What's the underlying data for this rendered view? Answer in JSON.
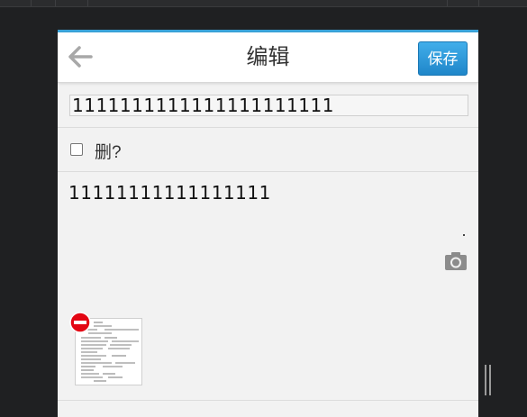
{
  "header": {
    "title": "编辑",
    "save_label": "保存",
    "back_icon": "arrow-left-icon"
  },
  "form": {
    "title_value": "1111111111111111111111",
    "delete_label": "删?",
    "delete_checked": false,
    "content_text": "11111111111111111"
  },
  "attachments": {
    "camera_icon": "camera-icon",
    "remove_icon": "minus-circle-icon"
  },
  "colors": {
    "accent": "#3aa4da",
    "save_button": "#2a94d6",
    "remove_badge": "#e30613",
    "background": "#1f2022"
  }
}
